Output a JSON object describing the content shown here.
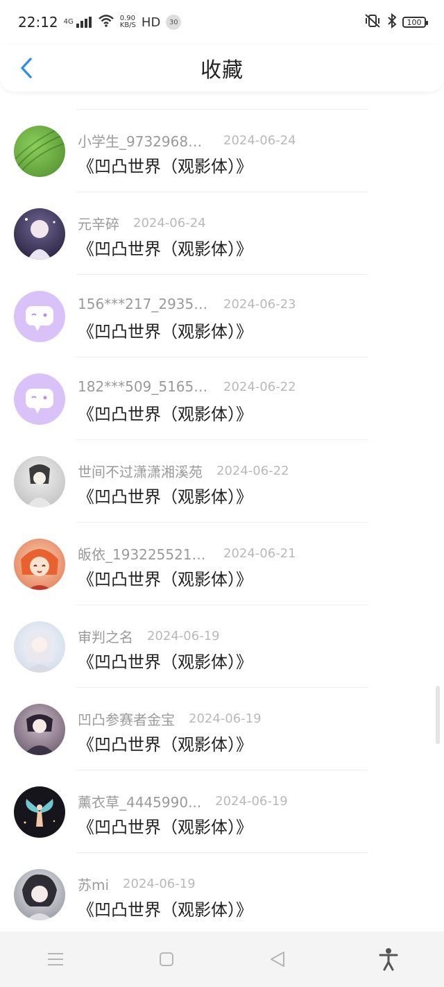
{
  "status_bar": {
    "time": "22:12",
    "network": "4G",
    "speed_value": "0.90",
    "speed_unit": "KB/S",
    "hd_label": "HD",
    "notification_count": "30",
    "battery": "100"
  },
  "header": {
    "title": "收藏"
  },
  "items": [
    {
      "username": "小学生_97329683...",
      "date": "2024-06-24",
      "book": "《凹凸世界（观影体）》",
      "avatar_color": "#6aa84f"
    },
    {
      "username": "元辛碎",
      "date": "2024-06-24",
      "book": "《凹凸世界（观影体）》",
      "avatar_color": "#3b3555"
    },
    {
      "username": "156***217_29351...",
      "date": "2024-06-23",
      "book": "《凹凸世界（观影体）》",
      "avatar_color": "#d9c2f7"
    },
    {
      "username": "182***509_51656...",
      "date": "2024-06-22",
      "book": "《凹凸世界（观影体）》",
      "avatar_color": "#d9c2f7"
    },
    {
      "username": "世间不过潇潇湘溪苑",
      "date": "2024-06-22",
      "book": "《凹凸世界（观影体）》",
      "avatar_color": "#cfcfcf"
    },
    {
      "username": "皈依_1932255213...",
      "date": "2024-06-21",
      "book": "《凹凸世界（观影体）》",
      "avatar_color": "#e2714e"
    },
    {
      "username": "审判之名",
      "date": "2024-06-19",
      "book": "《凹凸世界（观影体）》",
      "avatar_color": "#dfe6f1"
    },
    {
      "username": "凹凸参赛者金宝",
      "date": "2024-06-19",
      "book": "《凹凸世界（观影体）》",
      "avatar_color": "#6b5e73"
    },
    {
      "username": "薰衣草_4445990...",
      "date": "2024-06-19",
      "book": "《凹凸世界（观影体）》",
      "avatar_color": "#1b1b22"
    },
    {
      "username": "苏mi",
      "date": "2024-06-19",
      "book": "《凹凸世界（观影体）》",
      "avatar_color": "#8b8b95"
    }
  ],
  "colors": {
    "accent": "#2f8ff0",
    "avatar_chat": "#d9c2f7"
  },
  "icons": {
    "back": "chevron-left-icon",
    "menu": "menu-icon",
    "home": "square-icon",
    "back_nav": "triangle-back-icon",
    "accessibility": "accessibility-icon"
  }
}
